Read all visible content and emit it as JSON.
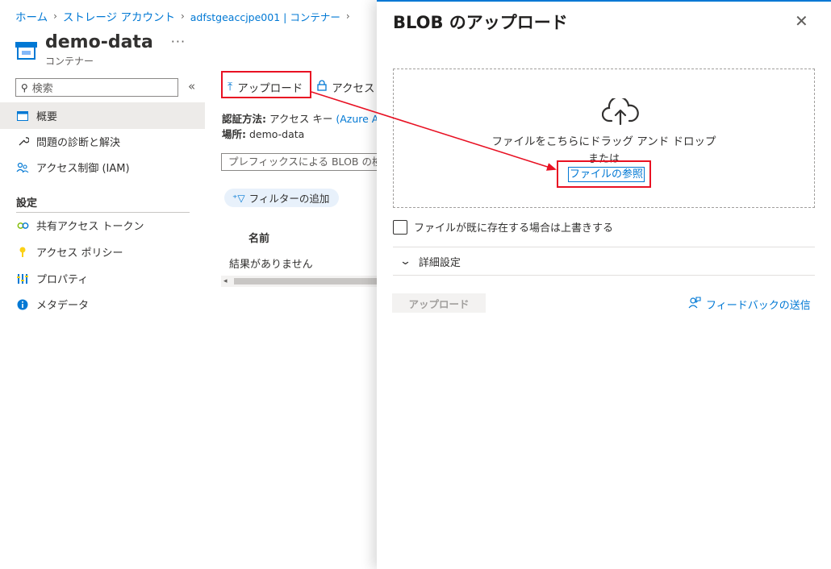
{
  "breadcrumb": [
    "ホーム",
    "ストレージ アカウント",
    "adfstgeaccjpe001 | コンテナー"
  ],
  "page": {
    "title": "demo-data",
    "subtitle": "コンテナー",
    "more": "···"
  },
  "sidebar": {
    "search_placeholder": "検索",
    "items": [
      {
        "label": "概要",
        "icon": "overview-icon"
      },
      {
        "label": "問題の診断と解決",
        "icon": "wrench-icon"
      },
      {
        "label": "アクセス制御 (IAM)",
        "icon": "people-icon"
      }
    ],
    "section_title": "設定",
    "settings_items": [
      {
        "label": "共有アクセス トークン",
        "icon": "link-icon"
      },
      {
        "label": "アクセス ポリシー",
        "icon": "key-icon"
      },
      {
        "label": "プロパティ",
        "icon": "properties-icon"
      },
      {
        "label": "メタデータ",
        "icon": "info-icon"
      }
    ]
  },
  "toolbar": {
    "upload_label": "アップロード",
    "access_label": "アクセス"
  },
  "details": {
    "auth_label": "認証方法:",
    "auth_value": "アクセス キー",
    "auth_link": "(Azure AD",
    "location_label": "場所:",
    "location_value": "demo-data"
  },
  "list": {
    "prefix_placeholder": "プレフィックスによる BLOB の検索",
    "filter_label": "フィルターの追加",
    "column_name": "名前",
    "empty_text": "結果がありません"
  },
  "panel": {
    "title": "BLOB のアップロード",
    "drop_text": "ファイルをこちらにドラッグ アンド ドロップ",
    "or_text": "または",
    "browse_link": "ファイルの参照",
    "overwrite_label": "ファイルが既に存在する場合は上書きする",
    "advanced_label": "詳細設定",
    "upload_button": "アップロード",
    "feedback_label": "フィードバックの送信"
  },
  "colors": {
    "accent": "#0078d4",
    "highlight": "#e81123",
    "selected_bg": "#edebe9"
  }
}
